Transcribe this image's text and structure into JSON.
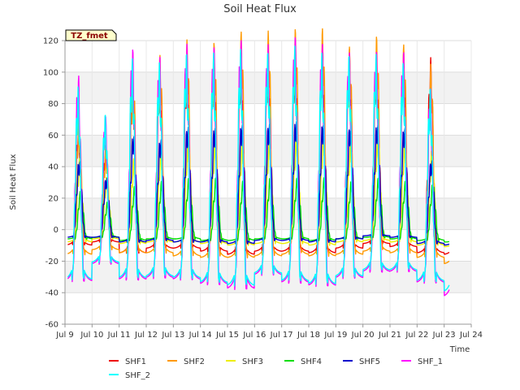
{
  "chart_data": {
    "type": "line",
    "title": "Soil Heat Flux",
    "xlabel": "Time",
    "ylabel": "Soil Heat Flux",
    "annotation": "TZ_fmet",
    "ylim": [
      -60,
      120
    ],
    "yticks": [
      -60,
      -40,
      -20,
      0,
      20,
      40,
      60,
      80,
      100,
      120
    ],
    "xlim": [
      9.0,
      24.0
    ],
    "xticks": [
      {
        "v": 9,
        "label": "Jul 9"
      },
      {
        "v": 10,
        "label": "Jul 10"
      },
      {
        "v": 11,
        "label": "Jul 11"
      },
      {
        "v": 12,
        "label": "Jul 12"
      },
      {
        "v": 13,
        "label": "Jul 13"
      },
      {
        "v": 14,
        "label": "Jul 14"
      },
      {
        "v": 15,
        "label": "Jul 15"
      },
      {
        "v": 16,
        "label": "Jul 16"
      },
      {
        "v": 17,
        "label": "Jul 17"
      },
      {
        "v": 18,
        "label": "Jul 18"
      },
      {
        "v": 19,
        "label": "Jul 19"
      },
      {
        "v": 20,
        "label": "Jul 20"
      },
      {
        "v": 21,
        "label": "Jul 21"
      },
      {
        "v": 22,
        "label": "Jul 22"
      },
      {
        "v": 23,
        "label": "Jul 23"
      },
      {
        "v": 24,
        "label": "Jul 24"
      }
    ],
    "grid": true,
    "legend_position": "bottom",
    "series": [
      {
        "name": "SHF1",
        "color": "#ee0000",
        "peaks": [
          60,
          47,
          84,
          90,
          95,
          97,
          98,
          100,
          100,
          102,
          101,
          98,
          101,
          96,
          75
        ],
        "troughs": [
          -10,
          -8,
          -15,
          -12,
          -12,
          -14,
          -16,
          -14,
          -14,
          -15,
          -12,
          -9,
          -11,
          -15,
          -16
        ]
      },
      {
        "name": "SHF2",
        "color": "#ff9900",
        "peaks": [
          62,
          45,
          90,
          98,
          106,
          105,
          111,
          111,
          113,
          113,
          102,
          109,
          104,
          92,
          72
        ],
        "troughs": [
          -16,
          -13,
          -15,
          -15,
          -17,
          -18,
          -18,
          -17,
          -16,
          -17,
          -16,
          -14,
          -15,
          -18,
          -22
        ]
      },
      {
        "name": "SHF3",
        "color": "#eeee00",
        "peaks": [
          40,
          30,
          40,
          45,
          50,
          52,
          50,
          52,
          55,
          56,
          50,
          53,
          50,
          45,
          38
        ],
        "troughs": [
          -8,
          -6,
          -9,
          -8,
          -8,
          -9,
          -10,
          -9,
          -9,
          -10,
          -8,
          -7,
          -8,
          -10,
          -11
        ]
      },
      {
        "name": "SHF4",
        "color": "#00dd00",
        "peaks": [
          22,
          16,
          25,
          28,
          30,
          30,
          28,
          30,
          30,
          30,
          28,
          30,
          28,
          26,
          24
        ],
        "troughs": [
          -6,
          -5,
          -7,
          -6,
          -6,
          -7,
          -7,
          -6,
          -6,
          -7,
          -6,
          -5,
          -6,
          -7,
          -8
        ]
      },
      {
        "name": "SHF5",
        "color": "#0000cc",
        "peaks": [
          40,
          30,
          55,
          53,
          60,
          60,
          62,
          62,
          64,
          63,
          61,
          62,
          60,
          40,
          38
        ],
        "troughs": [
          -5,
          -5,
          -8,
          -7,
          -8,
          -8,
          -9,
          -7,
          -7,
          -8,
          -6,
          -4,
          -5,
          -9,
          -10
        ]
      },
      {
        "name": "SHF_1",
        "color": "#ff00ff",
        "peaks": [
          86,
          63,
          102,
          97,
          104,
          103,
          106,
          104,
          109,
          104,
          99,
          101,
          100,
          78,
          70
        ],
        "troughs": [
          -33,
          -22,
          -32,
          -31,
          -32,
          -35,
          -38,
          -29,
          -34,
          -36,
          -31,
          -27,
          -27,
          -34,
          -43
        ]
      },
      {
        "name": "SHF_2",
        "color": "#00ffff",
        "peaks": [
          78,
          64,
          94,
          92,
          98,
          97,
          99,
          99,
          101,
          97,
          97,
          97,
          92,
          78,
          66
        ],
        "troughs": [
          -32,
          -21,
          -31,
          -30,
          -31,
          -34,
          -36,
          -28,
          -33,
          -35,
          -30,
          -26,
          -26,
          -33,
          -40
        ]
      }
    ]
  }
}
